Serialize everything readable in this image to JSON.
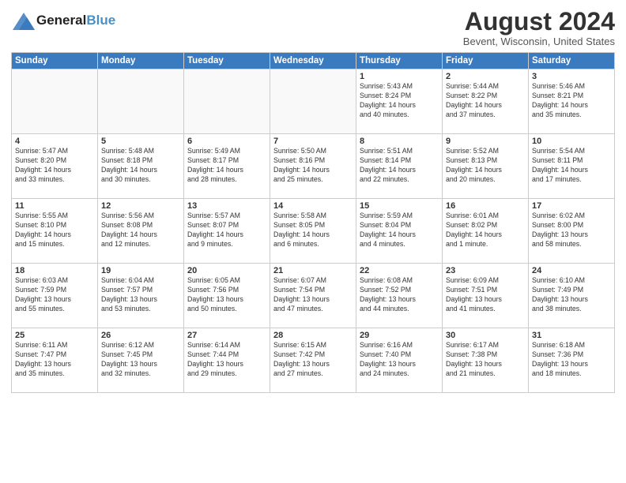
{
  "header": {
    "logo": {
      "general": "General",
      "blue": "Blue"
    },
    "title": "August 2024",
    "location": "Bevent, Wisconsin, United States"
  },
  "calendar": {
    "days_of_week": [
      "Sunday",
      "Monday",
      "Tuesday",
      "Wednesday",
      "Thursday",
      "Friday",
      "Saturday"
    ],
    "weeks": [
      [
        {
          "day": "",
          "info": ""
        },
        {
          "day": "",
          "info": ""
        },
        {
          "day": "",
          "info": ""
        },
        {
          "day": "",
          "info": ""
        },
        {
          "day": "1",
          "info": "Sunrise: 5:43 AM\nSunset: 8:24 PM\nDaylight: 14 hours\nand 40 minutes."
        },
        {
          "day": "2",
          "info": "Sunrise: 5:44 AM\nSunset: 8:22 PM\nDaylight: 14 hours\nand 37 minutes."
        },
        {
          "day": "3",
          "info": "Sunrise: 5:46 AM\nSunset: 8:21 PM\nDaylight: 14 hours\nand 35 minutes."
        }
      ],
      [
        {
          "day": "4",
          "info": "Sunrise: 5:47 AM\nSunset: 8:20 PM\nDaylight: 14 hours\nand 33 minutes."
        },
        {
          "day": "5",
          "info": "Sunrise: 5:48 AM\nSunset: 8:18 PM\nDaylight: 14 hours\nand 30 minutes."
        },
        {
          "day": "6",
          "info": "Sunrise: 5:49 AM\nSunset: 8:17 PM\nDaylight: 14 hours\nand 28 minutes."
        },
        {
          "day": "7",
          "info": "Sunrise: 5:50 AM\nSunset: 8:16 PM\nDaylight: 14 hours\nand 25 minutes."
        },
        {
          "day": "8",
          "info": "Sunrise: 5:51 AM\nSunset: 8:14 PM\nDaylight: 14 hours\nand 22 minutes."
        },
        {
          "day": "9",
          "info": "Sunrise: 5:52 AM\nSunset: 8:13 PM\nDaylight: 14 hours\nand 20 minutes."
        },
        {
          "day": "10",
          "info": "Sunrise: 5:54 AM\nSunset: 8:11 PM\nDaylight: 14 hours\nand 17 minutes."
        }
      ],
      [
        {
          "day": "11",
          "info": "Sunrise: 5:55 AM\nSunset: 8:10 PM\nDaylight: 14 hours\nand 15 minutes."
        },
        {
          "day": "12",
          "info": "Sunrise: 5:56 AM\nSunset: 8:08 PM\nDaylight: 14 hours\nand 12 minutes."
        },
        {
          "day": "13",
          "info": "Sunrise: 5:57 AM\nSunset: 8:07 PM\nDaylight: 14 hours\nand 9 minutes."
        },
        {
          "day": "14",
          "info": "Sunrise: 5:58 AM\nSunset: 8:05 PM\nDaylight: 14 hours\nand 6 minutes."
        },
        {
          "day": "15",
          "info": "Sunrise: 5:59 AM\nSunset: 8:04 PM\nDaylight: 14 hours\nand 4 minutes."
        },
        {
          "day": "16",
          "info": "Sunrise: 6:01 AM\nSunset: 8:02 PM\nDaylight: 14 hours\nand 1 minute."
        },
        {
          "day": "17",
          "info": "Sunrise: 6:02 AM\nSunset: 8:00 PM\nDaylight: 13 hours\nand 58 minutes."
        }
      ],
      [
        {
          "day": "18",
          "info": "Sunrise: 6:03 AM\nSunset: 7:59 PM\nDaylight: 13 hours\nand 55 minutes."
        },
        {
          "day": "19",
          "info": "Sunrise: 6:04 AM\nSunset: 7:57 PM\nDaylight: 13 hours\nand 53 minutes."
        },
        {
          "day": "20",
          "info": "Sunrise: 6:05 AM\nSunset: 7:56 PM\nDaylight: 13 hours\nand 50 minutes."
        },
        {
          "day": "21",
          "info": "Sunrise: 6:07 AM\nSunset: 7:54 PM\nDaylight: 13 hours\nand 47 minutes."
        },
        {
          "day": "22",
          "info": "Sunrise: 6:08 AM\nSunset: 7:52 PM\nDaylight: 13 hours\nand 44 minutes."
        },
        {
          "day": "23",
          "info": "Sunrise: 6:09 AM\nSunset: 7:51 PM\nDaylight: 13 hours\nand 41 minutes."
        },
        {
          "day": "24",
          "info": "Sunrise: 6:10 AM\nSunset: 7:49 PM\nDaylight: 13 hours\nand 38 minutes."
        }
      ],
      [
        {
          "day": "25",
          "info": "Sunrise: 6:11 AM\nSunset: 7:47 PM\nDaylight: 13 hours\nand 35 minutes."
        },
        {
          "day": "26",
          "info": "Sunrise: 6:12 AM\nSunset: 7:45 PM\nDaylight: 13 hours\nand 32 minutes."
        },
        {
          "day": "27",
          "info": "Sunrise: 6:14 AM\nSunset: 7:44 PM\nDaylight: 13 hours\nand 29 minutes."
        },
        {
          "day": "28",
          "info": "Sunrise: 6:15 AM\nSunset: 7:42 PM\nDaylight: 13 hours\nand 27 minutes."
        },
        {
          "day": "29",
          "info": "Sunrise: 6:16 AM\nSunset: 7:40 PM\nDaylight: 13 hours\nand 24 minutes."
        },
        {
          "day": "30",
          "info": "Sunrise: 6:17 AM\nSunset: 7:38 PM\nDaylight: 13 hours\nand 21 minutes."
        },
        {
          "day": "31",
          "info": "Sunrise: 6:18 AM\nSunset: 7:36 PM\nDaylight: 13 hours\nand 18 minutes."
        }
      ]
    ]
  }
}
